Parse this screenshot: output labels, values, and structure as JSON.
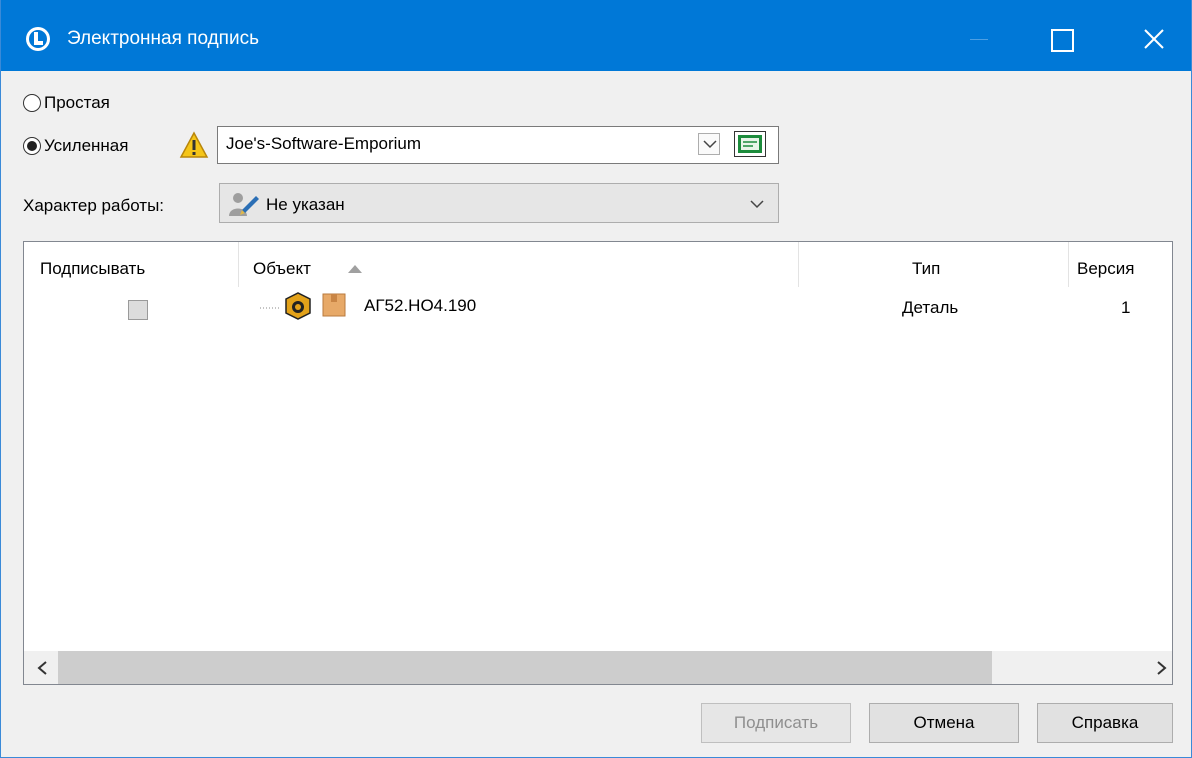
{
  "window": {
    "title": "Электронная подпись"
  },
  "signature_mode": {
    "simple_label": "Простая",
    "enhanced_label": "Усиленная",
    "selected": "enhanced",
    "certificate_value": "Joe's-Software-Emporium"
  },
  "work_type": {
    "label": "Характер работы:",
    "value": "Не указан"
  },
  "table": {
    "columns": [
      "Подписывать",
      "Объект",
      "Тип",
      "Версия"
    ],
    "sorted_column": "Объект",
    "rows": [
      {
        "sign": false,
        "object": "АГ52.НО4.190",
        "type": "Деталь",
        "version": "1"
      }
    ]
  },
  "buttons": {
    "sign": "Подписать",
    "cancel": "Отмена",
    "help": "Справка"
  },
  "colors": {
    "titlebar": "#0078d7",
    "warning": "#f5c518"
  }
}
